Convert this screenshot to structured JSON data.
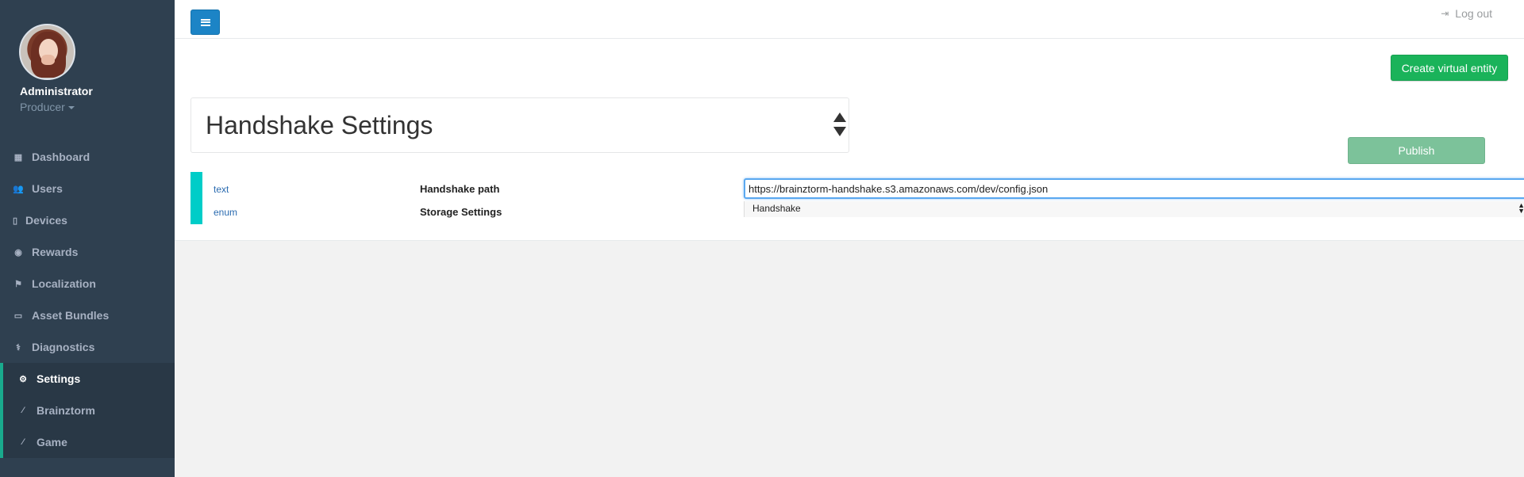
{
  "user": {
    "name": "Administrator",
    "role": "Producer"
  },
  "nav": {
    "items": [
      {
        "label": "Dashboard",
        "icon": "dashboard-icon"
      },
      {
        "label": "Users",
        "icon": "users-icon"
      },
      {
        "label": "Devices",
        "icon": "mobile-icon"
      },
      {
        "label": "Rewards",
        "icon": "gamepad-icon"
      },
      {
        "label": "Localization",
        "icon": "flag-icon"
      },
      {
        "label": "Asset Bundles",
        "icon": "folder-open-icon"
      },
      {
        "label": "Diagnostics",
        "icon": "stethoscope-icon"
      },
      {
        "label": "Settings",
        "icon": "gears-icon"
      },
      {
        "label": "Brainztorm",
        "icon": "magic-wand-icon"
      },
      {
        "label": "Game",
        "icon": "magic-wand-icon"
      }
    ]
  },
  "topbar": {
    "logout_label": "Log out"
  },
  "toolbar": {
    "create_label": "Create virtual entity",
    "publish_label": "Publish"
  },
  "section": {
    "title": "Handshake Settings"
  },
  "settings": {
    "rows": [
      {
        "type": "text",
        "label": "Handshake path",
        "value": "https://brainztorm-handshake.s3.amazonaws.com/dev/config.json"
      },
      {
        "type": "enum",
        "label": "Storage Settings",
        "value": "Handshake"
      }
    ]
  },
  "colors": {
    "sidebar": "#2f4050",
    "accent": "#19aa8d",
    "primary": "#1c84c6",
    "success": "#1ab35a",
    "row_accent": "#00cdc8"
  }
}
